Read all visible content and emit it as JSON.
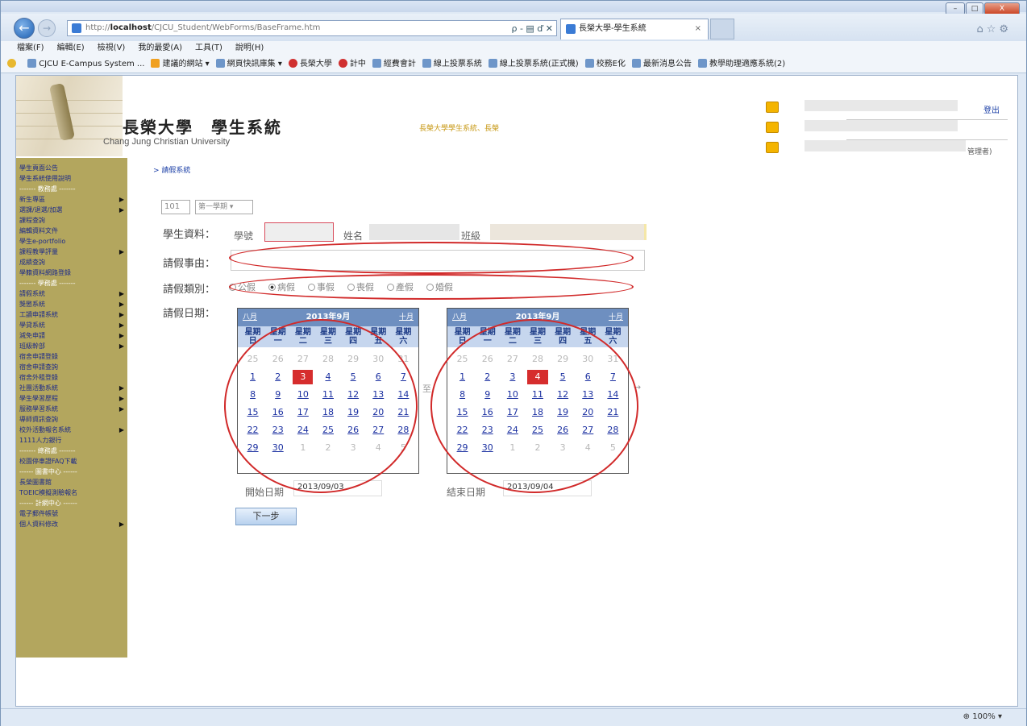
{
  "browser": {
    "address_prefix": "http://",
    "address_host": "localhost",
    "address_path": "/CJCU_Student/WebForms/BaseFrame.htm",
    "address_tools": "ρ - ▤ ď ✕",
    "tab_title": "長榮大學-學生系統",
    "tab_close": "×",
    "menu": [
      "檔案(F)",
      "編輯(E)",
      "檢視(V)",
      "我的最愛(A)",
      "工具(T)",
      "說明(H)"
    ],
    "favorites": [
      {
        "label": "CJCU E-Campus System ...",
        "icon": "page-icon",
        "kind": "page"
      },
      {
        "label": "建議的網站 ▾",
        "icon": "orange-icon",
        "kind": "orange"
      },
      {
        "label": "網頁快訊庫集 ▾",
        "icon": "page-icon",
        "kind": "page"
      },
      {
        "label": "長榮大學",
        "icon": "red-icon",
        "kind": "red"
      },
      {
        "label": "計中",
        "icon": "red-icon",
        "kind": "red"
      },
      {
        "label": "經費會計",
        "icon": "page-icon",
        "kind": "page"
      },
      {
        "label": "線上投票系統",
        "icon": "page-icon",
        "kind": "page"
      },
      {
        "label": "線上投票系統(正式機)",
        "icon": "page-icon",
        "kind": "page"
      },
      {
        "label": "校務E化",
        "icon": "page-icon",
        "kind": "page"
      },
      {
        "label": "最新消息公告",
        "icon": "page-icon",
        "kind": "page"
      },
      {
        "label": "教學助理適應系統(2)",
        "icon": "page-icon",
        "kind": "page"
      }
    ],
    "zoom": "⊕ 100% ▾",
    "win_min": "–",
    "win_max": "□",
    "win_close": "X"
  },
  "header": {
    "title": "長榮大學　學生系統",
    "subtitle": "Chang Jung Christian University",
    "notice": "長榮大學學生系統、長榮",
    "logout": "登出",
    "user_suffix": "管理者)"
  },
  "sidebar": {
    "items": [
      {
        "label": "學生頁面公告",
        "type": "item",
        "arrow": ""
      },
      {
        "label": "學生系統使用說明",
        "type": "item",
        "arrow": ""
      },
      {
        "label": "------- 教務處 -------",
        "type": "sep",
        "arrow": ""
      },
      {
        "label": "新生專區",
        "type": "item",
        "arrow": "▶"
      },
      {
        "label": "選課/退選/加選",
        "type": "item",
        "arrow": "▶"
      },
      {
        "label": "課程查詢",
        "type": "item",
        "arrow": ""
      },
      {
        "label": "編輯資料文件",
        "type": "item",
        "arrow": ""
      },
      {
        "label": "學生e-portfolio",
        "type": "item",
        "arrow": ""
      },
      {
        "label": "課程教學評量",
        "type": "item",
        "arrow": "▶"
      },
      {
        "label": "成績查詢",
        "type": "item",
        "arrow": ""
      },
      {
        "label": "學籍資料網路登錄",
        "type": "item",
        "arrow": ""
      },
      {
        "label": "------- 學務處 -------",
        "type": "sep",
        "arrow": ""
      },
      {
        "label": "請假系統",
        "type": "item",
        "arrow": "▶"
      },
      {
        "label": "獎懲系統",
        "type": "item",
        "arrow": "▶"
      },
      {
        "label": "工讀申請系統",
        "type": "item",
        "arrow": "▶"
      },
      {
        "label": "學貸系統",
        "type": "item",
        "arrow": "▶"
      },
      {
        "label": "減免申請",
        "type": "item",
        "arrow": "▶"
      },
      {
        "label": "班級幹部",
        "type": "item",
        "arrow": "▶"
      },
      {
        "label": "宿舍申請登錄",
        "type": "item",
        "arrow": ""
      },
      {
        "label": "宿舍申請查詢",
        "type": "item",
        "arrow": ""
      },
      {
        "label": "宿舍外租登錄",
        "type": "item",
        "arrow": ""
      },
      {
        "label": "社團活動系統",
        "type": "item",
        "arrow": "▶"
      },
      {
        "label": "學生學習歷程",
        "type": "item",
        "arrow": "▶"
      },
      {
        "label": "服務學習系統",
        "type": "item",
        "arrow": "▶"
      },
      {
        "label": "導師資訊查詢",
        "type": "item",
        "arrow": ""
      },
      {
        "label": "校外活動報名系統",
        "type": "item",
        "arrow": "▶"
      },
      {
        "label": "1111人力銀行",
        "type": "item",
        "arrow": ""
      },
      {
        "label": "------- 總務處 -------",
        "type": "sep",
        "arrow": ""
      },
      {
        "label": "校園停車證FAQ下載",
        "type": "item",
        "arrow": ""
      },
      {
        "label": "------ 圖書中心 ------",
        "type": "sep",
        "arrow": ""
      },
      {
        "label": "長榮圖書館",
        "type": "item",
        "arrow": ""
      },
      {
        "label": "TOEIC模擬測驗報名",
        "type": "item",
        "arrow": ""
      },
      {
        "label": "------ 計網中心 ------",
        "type": "sep",
        "arrow": ""
      },
      {
        "label": "電子郵件帳號",
        "type": "item",
        "arrow": ""
      },
      {
        "label": "個人資料修改",
        "type": "item",
        "arrow": "▶"
      }
    ]
  },
  "main": {
    "breadcrumb": "> 請假系統",
    "year": "101",
    "term": "第一學期 ▾",
    "student_info_label": "學生資料：",
    "student_id_label": "學號",
    "name_label": "姓名",
    "class_label": "班級",
    "reason_label": "請假事由：",
    "category_label": "請假類別：",
    "date_label": "請假日期：",
    "categories": [
      {
        "label": "公假",
        "selected": false
      },
      {
        "label": "病假",
        "selected": true
      },
      {
        "label": "事假",
        "selected": false
      },
      {
        "label": "喪假",
        "selected": false
      },
      {
        "label": "產假",
        "selected": false
      },
      {
        "label": "婚假",
        "selected": false
      }
    ],
    "start_date_label": "開始日期",
    "start_date_value": "2013/09/03",
    "end_date_label": "結束日期",
    "end_date_value": "2013/09/04",
    "next_button": "下一步",
    "range_sep": "至",
    "range_arrow": "→"
  },
  "calendars": [
    {
      "title": "2013年9月",
      "prev": "八月",
      "next": "十月",
      "dow": [
        [
          "星期",
          "日"
        ],
        [
          "星期",
          "一"
        ],
        [
          "星期",
          "二"
        ],
        [
          "星期",
          "三"
        ],
        [
          "星期",
          "四"
        ],
        [
          "星期",
          "五"
        ],
        [
          "星期",
          "六"
        ]
      ],
      "days": [
        [
          "25",
          1
        ],
        [
          "26",
          1
        ],
        [
          "27",
          1
        ],
        [
          "28",
          1
        ],
        [
          "29",
          1
        ],
        [
          "30",
          1
        ],
        [
          "31",
          1
        ],
        [
          "1",
          0
        ],
        [
          "2",
          0
        ],
        [
          "3",
          2
        ],
        [
          "4",
          0
        ],
        [
          "5",
          0
        ],
        [
          "6",
          0
        ],
        [
          "7",
          0
        ],
        [
          "8",
          0
        ],
        [
          "9",
          0
        ],
        [
          "10",
          0
        ],
        [
          "11",
          0
        ],
        [
          "12",
          0
        ],
        [
          "13",
          0
        ],
        [
          "14",
          0
        ],
        [
          "15",
          0
        ],
        [
          "16",
          0
        ],
        [
          "17",
          0
        ],
        [
          "18",
          0
        ],
        [
          "19",
          0
        ],
        [
          "20",
          0
        ],
        [
          "21",
          0
        ],
        [
          "22",
          0
        ],
        [
          "23",
          0
        ],
        [
          "24",
          0
        ],
        [
          "25",
          0
        ],
        [
          "26",
          0
        ],
        [
          "27",
          0
        ],
        [
          "28",
          0
        ],
        [
          "29",
          0
        ],
        [
          "30",
          0
        ],
        [
          "1",
          1
        ],
        [
          "2",
          1
        ],
        [
          "3",
          1
        ],
        [
          "4",
          1
        ],
        [
          "5",
          1
        ]
      ]
    },
    {
      "title": "2013年9月",
      "prev": "八月",
      "next": "十月",
      "dow": [
        [
          "星期",
          "日"
        ],
        [
          "星期",
          "一"
        ],
        [
          "星期",
          "二"
        ],
        [
          "星期",
          "三"
        ],
        [
          "星期",
          "四"
        ],
        [
          "星期",
          "五"
        ],
        [
          "星期",
          "六"
        ]
      ],
      "days": [
        [
          "25",
          1
        ],
        [
          "26",
          1
        ],
        [
          "27",
          1
        ],
        [
          "28",
          1
        ],
        [
          "29",
          1
        ],
        [
          "30",
          1
        ],
        [
          "31",
          1
        ],
        [
          "1",
          0
        ],
        [
          "2",
          0
        ],
        [
          "3",
          0
        ],
        [
          "4",
          2
        ],
        [
          "5",
          0
        ],
        [
          "6",
          0
        ],
        [
          "7",
          0
        ],
        [
          "8",
          0
        ],
        [
          "9",
          0
        ],
        [
          "10",
          0
        ],
        [
          "11",
          0
        ],
        [
          "12",
          0
        ],
        [
          "13",
          0
        ],
        [
          "14",
          0
        ],
        [
          "15",
          0
        ],
        [
          "16",
          0
        ],
        [
          "17",
          0
        ],
        [
          "18",
          0
        ],
        [
          "19",
          0
        ],
        [
          "20",
          0
        ],
        [
          "21",
          0
        ],
        [
          "22",
          0
        ],
        [
          "23",
          0
        ],
        [
          "24",
          0
        ],
        [
          "25",
          0
        ],
        [
          "26",
          0
        ],
        [
          "27",
          0
        ],
        [
          "28",
          0
        ],
        [
          "29",
          0
        ],
        [
          "30",
          0
        ],
        [
          "1",
          1
        ],
        [
          "2",
          1
        ],
        [
          "3",
          1
        ],
        [
          "4",
          1
        ],
        [
          "5",
          1
        ]
      ]
    }
  ],
  "annotation": {
    "ellipse_color": "#d12a2a",
    "selected_day_color": "#d62d2d"
  }
}
